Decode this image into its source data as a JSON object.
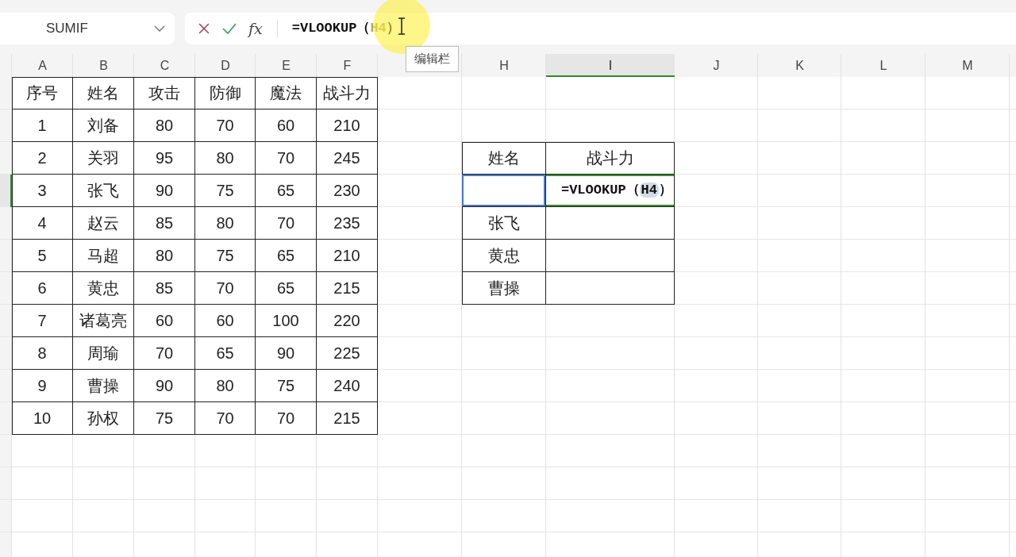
{
  "name_box": {
    "value": "SUMIF"
  },
  "formula_bar": {
    "fx_label": "fx",
    "formula": [
      {
        "text": "=VLOOKUP（",
        "kind": "plain"
      },
      {
        "text": "H4",
        "kind": "ref"
      },
      {
        "text": "）",
        "kind": "plain"
      }
    ]
  },
  "tooltip": {
    "text": "编辑栏"
  },
  "columns": [
    {
      "label": "A",
      "selected": false
    },
    {
      "label": "B",
      "selected": false
    },
    {
      "label": "C",
      "selected": false
    },
    {
      "label": "D",
      "selected": false
    },
    {
      "label": "E",
      "selected": false
    },
    {
      "label": "F",
      "selected": false
    },
    {
      "selected": false
    },
    {
      "label": "H",
      "selected": false
    },
    {
      "label": "I",
      "selected": true
    },
    {
      "label": "J",
      "selected": false
    },
    {
      "label": "K",
      "selected": false
    },
    {
      "label": "L",
      "selected": false
    },
    {
      "label": "M",
      "selected": false
    }
  ],
  "row_headers": [
    {
      "selected": false
    },
    {
      "selected": false
    },
    {
      "selected": false
    },
    {
      "selected": true
    },
    {
      "selected": false
    },
    {
      "selected": false
    },
    {
      "selected": false
    },
    {
      "selected": false
    },
    {
      "selected": false
    },
    {
      "selected": false
    },
    {
      "selected": false
    },
    {
      "selected": false
    },
    {
      "selected": false
    },
    {
      "selected": false
    },
    {
      "selected": false
    }
  ],
  "main_table": {
    "header": [
      "序号",
      "姓名",
      "攻击",
      "防御",
      "魔法",
      "战斗力"
    ],
    "rows": [
      [
        "1",
        "刘备",
        "80",
        "70",
        "60",
        "210"
      ],
      [
        "2",
        "关羽",
        "95",
        "80",
        "70",
        "245"
      ],
      [
        "3",
        "张飞",
        "90",
        "75",
        "65",
        "230"
      ],
      [
        "4",
        "赵云",
        "85",
        "80",
        "70",
        "235"
      ],
      [
        "5",
        "马超",
        "80",
        "75",
        "65",
        "210"
      ],
      [
        "6",
        "黄忠",
        "85",
        "70",
        "65",
        "215"
      ],
      [
        "7",
        "诸葛亮",
        "60",
        "60",
        "100",
        "220"
      ],
      [
        "8",
        "周瑜",
        "70",
        "65",
        "90",
        "225"
      ],
      [
        "9",
        "曹操",
        "90",
        "80",
        "75",
        "240"
      ],
      [
        "10",
        "孙权",
        "75",
        "70",
        "70",
        "215"
      ]
    ]
  },
  "lookup_table": {
    "header": [
      "姓名",
      "战斗力"
    ],
    "rows": [
      {
        "selected": true,
        "formula": [
          {
            "text": "=VLOOKUP（",
            "kind": "plain"
          },
          {
            "text": "H4",
            "kind": "ref"
          },
          {
            "text": "）",
            "kind": "plain"
          }
        ]
      },
      {
        "name": "张飞",
        "selected": false
      },
      {
        "name": "黄忠",
        "selected": false
      },
      {
        "name": "曹操",
        "selected": false
      }
    ]
  }
}
